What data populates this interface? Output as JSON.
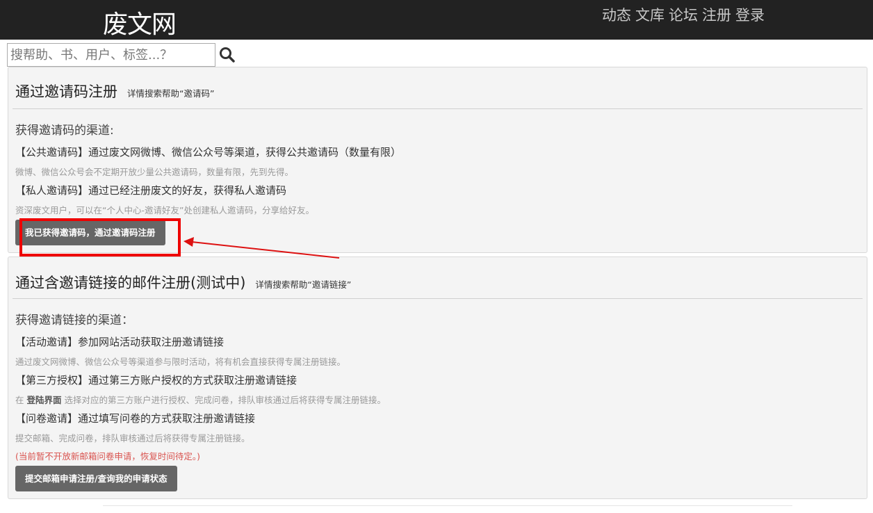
{
  "header": {
    "logo": "废文网",
    "nav": [
      "动态",
      "文库",
      "论坛",
      "注册",
      "登录"
    ]
  },
  "search": {
    "placeholder": "搜帮助、书、用户、标签...？",
    "icon": "search-icon"
  },
  "invite_code_panel": {
    "title": "通过邀请码注册",
    "help": "详情搜索帮助“邀请码”",
    "channels_label": "获得邀请码的渠道:",
    "items": [
      {
        "title": "【公共邀请码】通过废文网微博、微信公众号等渠道，获得公共邀请码（数量有限）",
        "desc": "微博、微信公众号会不定期开放少量公共邀请码，数量有限，先到先得。"
      },
      {
        "title": "【私人邀请码】通过已经注册废文的好友，获得私人邀请码",
        "desc": "资深废文用户，可以在“个人中心-邀请好友”处创建私人邀请码，分享给好友。"
      }
    ],
    "button": "我已获得邀请码，通过邀请码注册"
  },
  "invite_link_panel": {
    "title": "通过含邀请链接的邮件注册(测试中)",
    "help": "详情搜索帮助“邀请链接”",
    "channels_label": "获得邀请链接的渠道：",
    "items": [
      {
        "title": "【活动邀请】参加网站活动获取注册邀请链接",
        "desc": "通过废文网微博、微信公众号等渠道参与限时活动，将有机会直接获得专属注册链接。"
      },
      {
        "title": "【第三方授权】通过第三方账户授权的方式获取注册邀请链接",
        "desc_prefix": "在",
        "desc_bold": "登陆界面",
        "desc_suffix": "选择对应的第三方账户进行授权、完成问卷，排队审核通过后将获得专属注册链接。"
      },
      {
        "title": "【问卷邀请】通过填写问卷的方式获取注册邀请链接",
        "desc": "提交邮箱、完成问卷，排队审核通过后将获得专属注册链接。"
      }
    ],
    "notice": "(当前暂不开放新邮箱问卷申请，恢复时间待定。)",
    "button": "提交邮箱申请注册/查询我的申请状态"
  },
  "colors": {
    "topbar": "#222222",
    "button": "#666666",
    "highlight": "#ee0000",
    "notice": "#d9534f"
  }
}
